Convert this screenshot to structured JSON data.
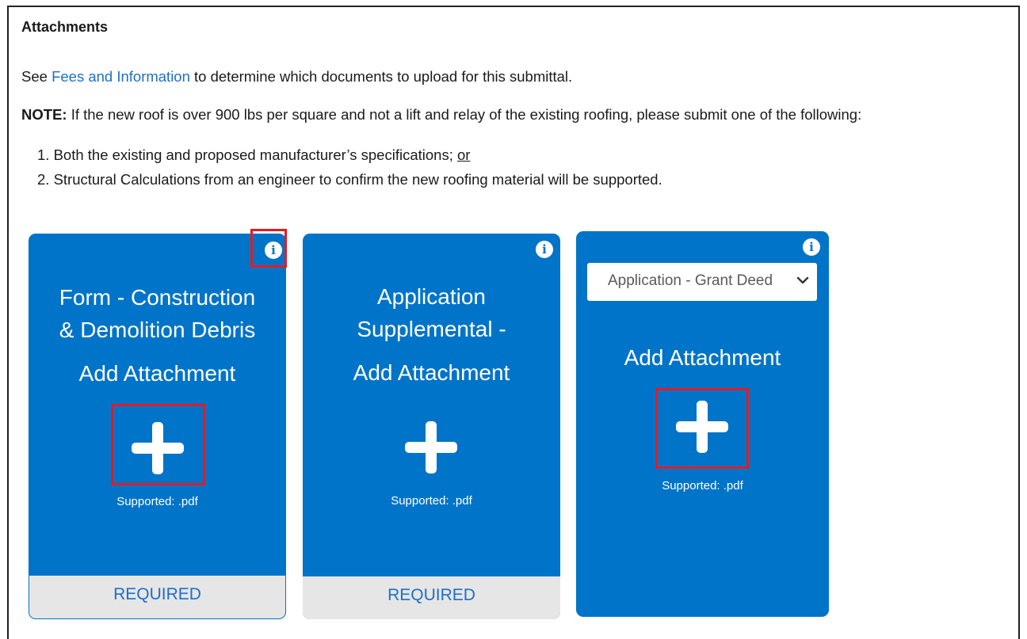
{
  "section": {
    "title": "Attachments"
  },
  "intro": {
    "prefix": "See ",
    "link": "Fees and Information",
    "suffix": " to determine which documents to upload for this submittal."
  },
  "note": {
    "label": "NOTE:",
    "text": " If the new roof is over 900 lbs per square and not a lift and relay of the existing roofing, please submit one of the following:"
  },
  "list": [
    {
      "num": "1.",
      "text": "Both the existing and proposed manufacturer’s specifications; ",
      "emph": "or"
    },
    {
      "num": "2.",
      "text": "Structural Calculations from an engineer to confirm the new roofing material will be supported."
    }
  ],
  "cards": [
    {
      "title_line1": "Form - Construction",
      "title_line2": "& Demolition Debris",
      "action": "Add Attachment",
      "supported": "Supported: .pdf",
      "footer": "REQUIRED",
      "info_icon": "info-icon",
      "add_icon": "plus-icon"
    },
    {
      "title_line1": "Application",
      "title_line2": "Supplemental -",
      "action": "Add Attachment",
      "supported": "Supported: .pdf",
      "footer": "REQUIRED",
      "info_icon": "info-icon",
      "add_icon": "plus-icon"
    },
    {
      "select_value": "Application - Grant Deed",
      "action": "Add Attachment",
      "supported": "Supported: .pdf",
      "info_icon": "info-icon",
      "add_icon": "plus-icon"
    }
  ],
  "colors": {
    "card_blue": "#0074c8",
    "link_blue": "#1f6fc5",
    "highlight_red": "#e31b23",
    "footer_gray": "#e6e6e6"
  }
}
